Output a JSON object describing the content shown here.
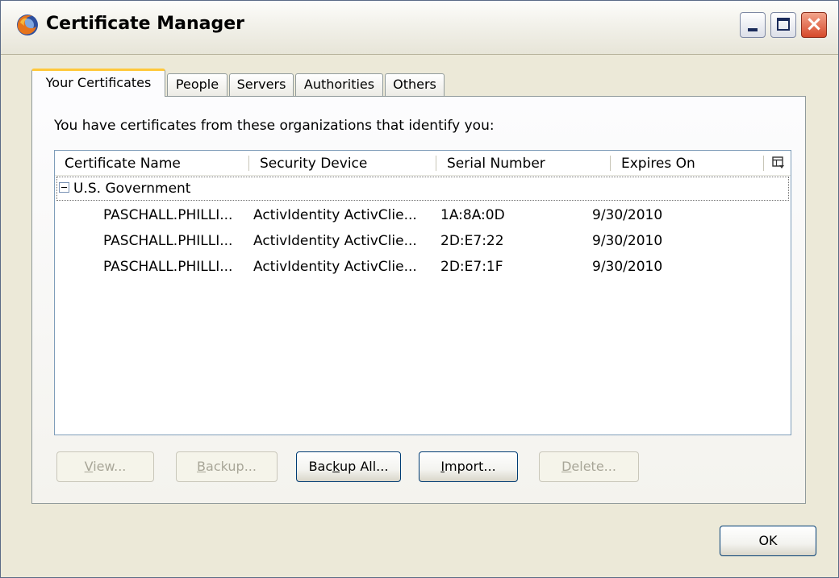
{
  "window": {
    "title": "Certificate Manager",
    "app_icon": "firefox-icon"
  },
  "tabs": [
    {
      "label": "Your Certificates",
      "active": true
    },
    {
      "label": "People",
      "active": false
    },
    {
      "label": "Servers",
      "active": false
    },
    {
      "label": "Authorities",
      "active": false
    },
    {
      "label": "Others",
      "active": false
    }
  ],
  "panel": {
    "intro": "You have certificates from these organizations that identify you:",
    "columns": [
      "Certificate Name",
      "Security Device",
      "Serial Number",
      "Expires On"
    ],
    "group": {
      "label": "U.S. Government",
      "expanded": true
    },
    "rows": [
      {
        "name": "PASCHALL.PHILLI...",
        "device": "ActivIdentity ActivClie...",
        "serial": "1A:8A:0D",
        "expires": "9/30/2010"
      },
      {
        "name": "PASCHALL.PHILLI...",
        "device": "ActivIdentity ActivClie...",
        "serial": "2D:E7:22",
        "expires": "9/30/2010"
      },
      {
        "name": "PASCHALL.PHILLI...",
        "device": "ActivIdentity ActivClie...",
        "serial": "2D:E7:1F",
        "expires": "9/30/2010"
      }
    ]
  },
  "buttons": {
    "view": {
      "accel": "V",
      "rest": "iew...",
      "enabled": false
    },
    "backup": {
      "accel": "B",
      "rest": "ackup...",
      "enabled": false
    },
    "backup_all": {
      "pre": "Bac",
      "accel": "k",
      "rest": "up All...",
      "enabled": true
    },
    "import": {
      "accel": "I",
      "rest": "mport...",
      "enabled": true
    },
    "delete": {
      "accel": "D",
      "rest": "elete...",
      "enabled": false
    },
    "ok": "OK"
  },
  "colors": {
    "window_bg": "#ece9d8",
    "active_tab_accent": "#ffc83c",
    "button_border": "#003c74",
    "disabled_text": "#a8a698"
  }
}
